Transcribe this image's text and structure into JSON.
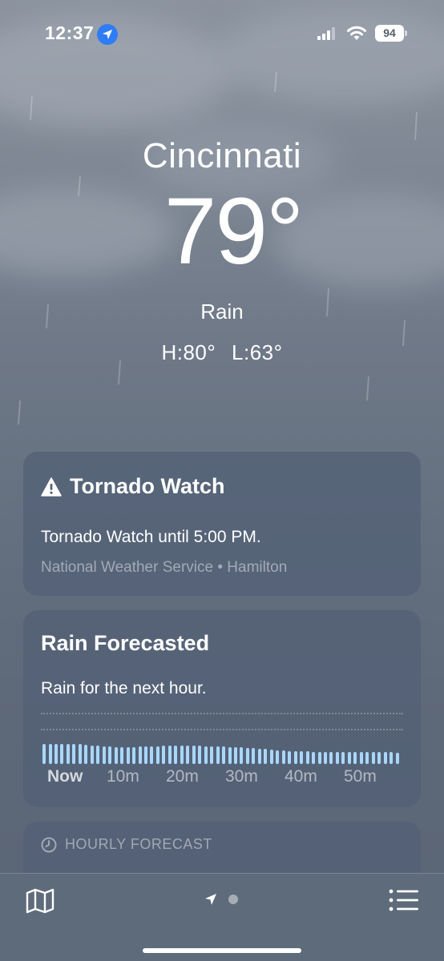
{
  "status_bar": {
    "time": "12:37",
    "battery": "94"
  },
  "hero": {
    "city": "Cincinnati",
    "temperature": "79°",
    "condition": "Rain",
    "high": "H:80°",
    "low": "L:63°"
  },
  "tornado_watch": {
    "title": "Tornado Watch",
    "body": "Tornado Watch until 5:00 PM.",
    "source": "National Weather Service • Hamilton"
  },
  "rain_forecast": {
    "title": "Rain Forecasted",
    "body": "Rain for the next hour.",
    "ticks": [
      "Now",
      "10m",
      "20m",
      "30m",
      "40m",
      "50m"
    ],
    "intensity": [
      0.82,
      0.84,
      0.85,
      0.85,
      0.84,
      0.83,
      0.82,
      0.8,
      0.78,
      0.76,
      0.74,
      0.72,
      0.71,
      0.7,
      0.7,
      0.71,
      0.72,
      0.73,
      0.74,
      0.75,
      0.76,
      0.77,
      0.78,
      0.78,
      0.78,
      0.77,
      0.76,
      0.75,
      0.74,
      0.73,
      0.72,
      0.71,
      0.7,
      0.69,
      0.68,
      0.66,
      0.64,
      0.62,
      0.6,
      0.58,
      0.56,
      0.55,
      0.54,
      0.53,
      0.52,
      0.51,
      0.5,
      0.5,
      0.5,
      0.5,
      0.5,
      0.5,
      0.5,
      0.5,
      0.5,
      0.5,
      0.5,
      0.5,
      0.49,
      0.48
    ]
  },
  "hourly": {
    "label": "HOURLY FORECAST"
  },
  "colors": {
    "rain_bar": "#a9d7fb",
    "location_badge": "#2f7cf6"
  }
}
